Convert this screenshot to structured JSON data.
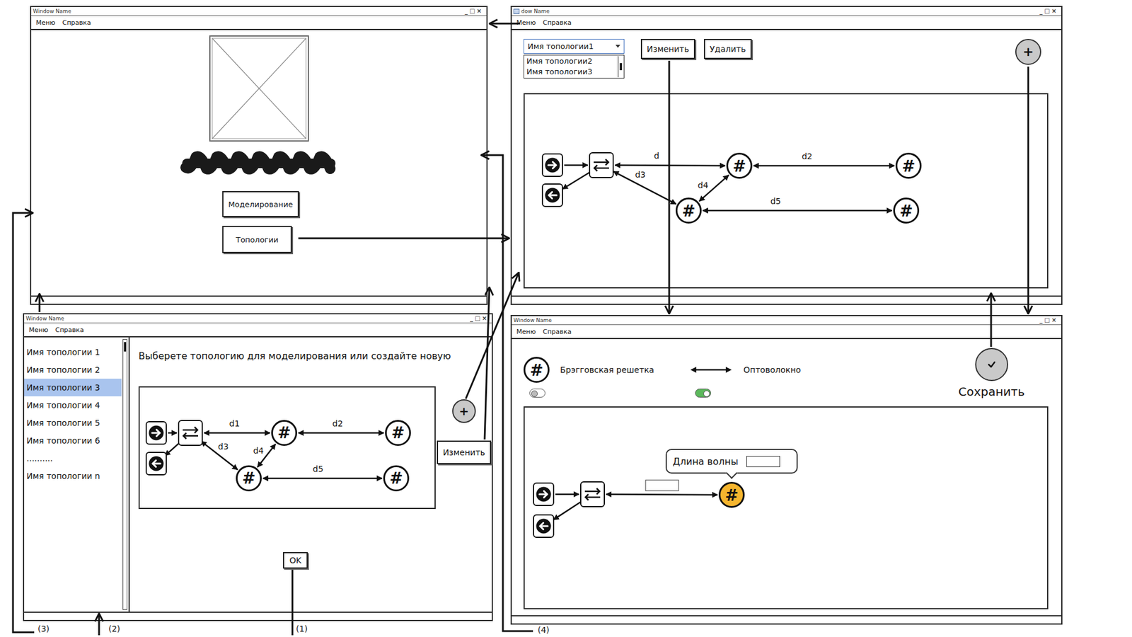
{
  "window_controls": [
    "_",
    "□",
    "×"
  ],
  "windows": {
    "main": {
      "title": "Window Name",
      "menu": [
        "Меню",
        "Справка"
      ],
      "buttons": [
        "Моделирование",
        "Топологии"
      ]
    },
    "topologies": {
      "title": "dow Name",
      "menu": [
        "Меню",
        "Справка"
      ],
      "dropdown": {
        "value": "Имя топологии1",
        "options": [
          "Имя топологии2",
          "Имя топологии3"
        ],
        "expanded": true
      },
      "buttons": [
        "Изменить",
        "Удалить"
      ],
      "add_button": "+",
      "diagram": {
        "nodes": [
          {
            "kind": "input",
            "selected": false
          },
          {
            "kind": "output",
            "selected": false
          },
          {
            "kind": "switch",
            "selected": false
          },
          {
            "kind": "grating",
            "symbol": "#",
            "selected": false
          },
          {
            "kind": "grating",
            "symbol": "#",
            "selected": false
          },
          {
            "kind": "grating",
            "symbol": "#",
            "selected": false
          },
          {
            "kind": "grating",
            "symbol": "#",
            "selected": false
          }
        ],
        "edges": [
          {
            "from": 0,
            "to": 2,
            "two_way": false
          },
          {
            "from": 2,
            "to": 1,
            "two_way": false
          },
          {
            "from": 2,
            "to": 3,
            "two_way": true,
            "label": "d"
          },
          {
            "from": 3,
            "to": 4,
            "two_way": true,
            "label": "d2"
          },
          {
            "from": 2,
            "to": 5,
            "two_way": true,
            "label": "d3"
          },
          {
            "from": 5,
            "to": 3,
            "two_way": true,
            "label": "d4"
          },
          {
            "from": 5,
            "to": 6,
            "two_way": true,
            "label": "d5"
          }
        ]
      }
    },
    "select": {
      "title": "Window Name",
      "menu": [
        "Меню",
        "Справка"
      ],
      "list": [
        {
          "label": "Имя топологии 1",
          "selected": false
        },
        {
          "label": "Имя топологии 2",
          "selected": false
        },
        {
          "label": "Имя топологии 3",
          "selected": true
        },
        {
          "label": "Имя топологии 4",
          "selected": false
        },
        {
          "label": "Имя топологии 5",
          "selected": false
        },
        {
          "label": "Имя топологии 6",
          "selected": false
        },
        {
          "label": "..........",
          "selected": false
        },
        {
          "label": "Имя топологии n",
          "selected": false
        }
      ],
      "heading": "Выберете топологию для моделирования или создайте новую",
      "diagram": {
        "nodes": [
          {
            "kind": "input",
            "selected": false
          },
          {
            "kind": "output",
            "selected": false
          },
          {
            "kind": "switch",
            "selected": false
          },
          {
            "kind": "grating",
            "symbol": "#",
            "selected": false
          },
          {
            "kind": "grating",
            "symbol": "#",
            "selected": false
          },
          {
            "kind": "grating",
            "symbol": "#",
            "selected": false
          },
          {
            "kind": "grating",
            "symbol": "#",
            "selected": false
          }
        ],
        "edges": [
          {
            "from": 0,
            "to": 2,
            "two_way": false
          },
          {
            "from": 2,
            "to": 1,
            "two_way": false
          },
          {
            "from": 2,
            "to": 3,
            "two_way": true,
            "label": "d1"
          },
          {
            "from": 3,
            "to": 4,
            "two_way": true,
            "label": "d2"
          },
          {
            "from": 2,
            "to": 5,
            "two_way": true,
            "label": "d3"
          },
          {
            "from": 5,
            "to": 3,
            "two_way": true,
            "label": "d4"
          },
          {
            "from": 5,
            "to": 6,
            "two_way": true,
            "label": "d5"
          }
        ]
      },
      "add_button": "+",
      "edit_button": "Изменить",
      "ok_button": "OK"
    },
    "editor": {
      "title": "Window Name",
      "menu": [
        "Меню",
        "Справка"
      ],
      "legend": [
        {
          "kind": "grating",
          "symbol": "#",
          "label": "Брэгговская решетка",
          "on": false
        },
        {
          "kind": "fiber",
          "label": "Оптоволокно",
          "on": true
        }
      ],
      "save_label": "Сохранить",
      "diagram": {
        "nodes": [
          {
            "kind": "input",
            "selected": false
          },
          {
            "kind": "output",
            "selected": false
          },
          {
            "kind": "switch",
            "selected": false
          },
          {
            "kind": "grating",
            "symbol": "#",
            "selected": true,
            "tooltip": {
              "label": "Длина волны",
              "value": ""
            }
          }
        ],
        "edges": [
          {
            "from": 0,
            "to": 2,
            "two_way": false
          },
          {
            "from": 2,
            "to": 1,
            "two_way": false
          },
          {
            "from": 2,
            "to": 3,
            "two_way": true,
            "input": {
              "value": ""
            }
          }
        ]
      }
    }
  },
  "flow_labels": [
    "(1)",
    "(2)",
    "(3)",
    "(4)"
  ]
}
